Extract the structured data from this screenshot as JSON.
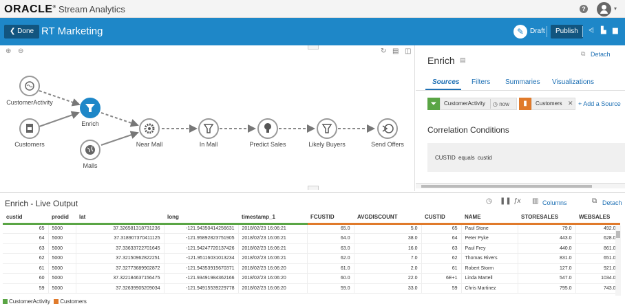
{
  "topbar": {
    "logo": "ORACLE",
    "product": "Stream Analytics",
    "help_icon": "help-icon",
    "user_icon": "user-avatar-icon"
  },
  "header": {
    "done_label": "Done",
    "title": "RT Marketing",
    "draft_label": "Draft",
    "publish_label": "Publish",
    "background": "#1e87c8"
  },
  "canvas": {
    "nodes": [
      {
        "label": "CustomerActivity",
        "icon": "stream-icon"
      },
      {
        "label": "Customers",
        "icon": "reference-file-icon"
      },
      {
        "label": "Enrich",
        "icon": "filter-funnel-icon"
      },
      {
        "label": "Malls",
        "icon": "globe-icon"
      },
      {
        "label": "Near Mall",
        "icon": "gear-icon"
      },
      {
        "label": "In Mall",
        "icon": "filter-funnel-icon"
      },
      {
        "label": "Predict Sales",
        "icon": "lightbulb-icon"
      },
      {
        "label": "Likely Buyers",
        "icon": "filter-funnel-icon"
      },
      {
        "label": "Send Offers",
        "icon": "target-arrow-icon"
      }
    ]
  },
  "panel": {
    "title": "Enrich",
    "detach_label": "Detach",
    "tabs": [
      "Sources",
      "Filters",
      "Summaries",
      "Visualizations"
    ],
    "active_tab": "Sources",
    "source_a": {
      "name": "CustomerActivity",
      "time": "now",
      "color": "#5aa545"
    },
    "source_b": {
      "name": "Customers",
      "color": "#e07a2b"
    },
    "add_source_label": "Add a Source",
    "correlation_title": "Correlation Conditions",
    "condition": {
      "left": "CUSTID",
      "op": "equals",
      "right": "custid"
    }
  },
  "live": {
    "title": "Enrich - Live Output",
    "columns_label": "Columns",
    "detach_label": "Detach",
    "headers": [
      "custid",
      "prodid",
      "lat",
      "long",
      "timestamp_1",
      "FCUSTID",
      "AVGDISCOUNT",
      "CUSTID",
      "NAME",
      "STORESALES",
      "WEBSALES"
    ],
    "rows": [
      [
        "65",
        "5000",
        "37.326581318731236",
        "-121.94350414256631",
        "2018/02/23 16:06:21",
        "65.0",
        "5.0",
        "65",
        "Paul Stone",
        "79.0",
        "492.0"
      ],
      [
        "64",
        "5000",
        "37.318907370411125",
        "-121.95892823751905",
        "2018/02/23 16:06:21",
        "64.0",
        "38.0",
        "64",
        "Peter Pyke",
        "443.0",
        "628.0"
      ],
      [
        "63",
        "5000",
        "37.33633722701645",
        "-121.94247720137426",
        "2018/02/23 16:06:21",
        "63.0",
        "16.0",
        "63",
        "Paul Frey",
        "440.0",
        "861.0"
      ],
      [
        "62",
        "5000",
        "37.32150962822251",
        "-121.95116031013234",
        "2018/02/23 16:06:21",
        "62.0",
        "7.0",
        "62",
        "Thomas Rivers",
        "831.0",
        "651.0"
      ],
      [
        "61",
        "5000",
        "37.32773689902872",
        "-121.94353915670371",
        "2018/02/23 16:06:20",
        "61.0",
        "2.0",
        "61",
        "Robert Storm",
        "127.0",
        "921.0"
      ],
      [
        "60",
        "5000",
        "37.322184637156475",
        "-121.93491984362166",
        "2018/02/23 16:06:20",
        "60.0",
        "22.0",
        "6E+1",
        "Linda Martell",
        "547.0",
        "1034.0"
      ],
      [
        "59",
        "5000",
        "37.32639905209034",
        "-121.94915539229778",
        "2018/02/23 16:06:20",
        "59.0",
        "33.0",
        "59",
        "Chris Martinez",
        "795.0",
        "743.0"
      ]
    ],
    "legend": [
      {
        "name": "CustomerActivity",
        "color": "#5aa545"
      },
      {
        "name": "Customers",
        "color": "#e07a2b"
      }
    ]
  }
}
